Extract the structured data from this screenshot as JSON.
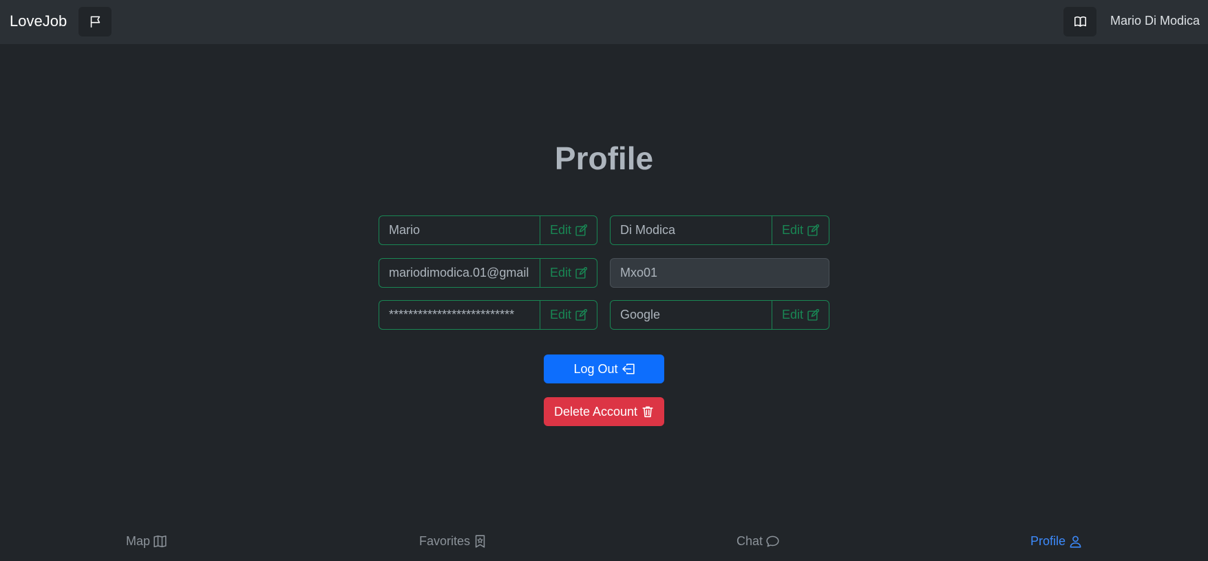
{
  "header": {
    "brand": "LoveJob",
    "flag_icon": "flag-icon",
    "book_icon": "book-icon",
    "username": "Mario Di Modica"
  },
  "main": {
    "title": "Profile",
    "edit_label": "Edit",
    "first_name": "Mario",
    "last_name": "Di Modica",
    "email": "mariodimodica.01@gmail",
    "username": "Mxo01",
    "password": "**************************",
    "provider": "Google",
    "logout_label": "Log Out",
    "delete_label": "Delete Account"
  },
  "nav": {
    "map": "Map",
    "favorites": "Favorites",
    "chat": "Chat",
    "profile": "Profile",
    "active": "profile"
  },
  "colors": {
    "background": "#212529",
    "topbar": "#2b3035",
    "success": "#198754",
    "primary": "#0d6efd",
    "danger": "#dc3545",
    "active_nav": "#3d8bfd"
  }
}
